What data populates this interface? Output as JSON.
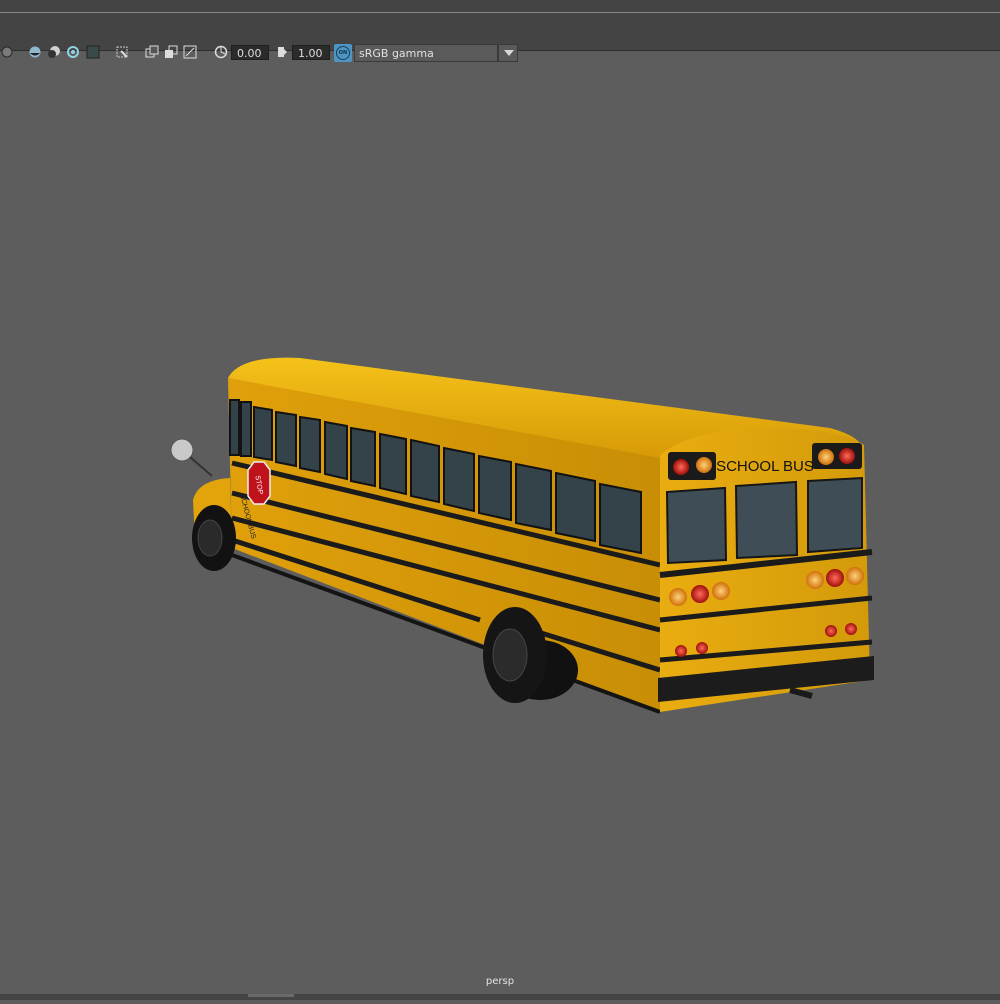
{
  "toolbar": {
    "exposure_value": "0.00",
    "gamma_value": "1.00",
    "color_mgmt_badge": "ON",
    "view_transform": "sRGB gamma",
    "icons": [
      "sphere-icon",
      "shaded-sphere-icon",
      "textured-sphere-icon",
      "isolate-select-icon",
      "grid-icon",
      "select-camera-icon",
      "xray-icon",
      "xray-joints-icon",
      "resolution-gate-icon",
      "exposure-icon",
      "gamma-icon",
      "color-management-icon"
    ]
  },
  "viewport": {
    "camera_name": "persp",
    "bus_sign_text": "SCHOOL BUS",
    "stop_sign_text": "STOP",
    "side_label_text": "SCHOOL BUS",
    "body_color": "#e8a80c",
    "background_color": "#5d5d5d"
  }
}
